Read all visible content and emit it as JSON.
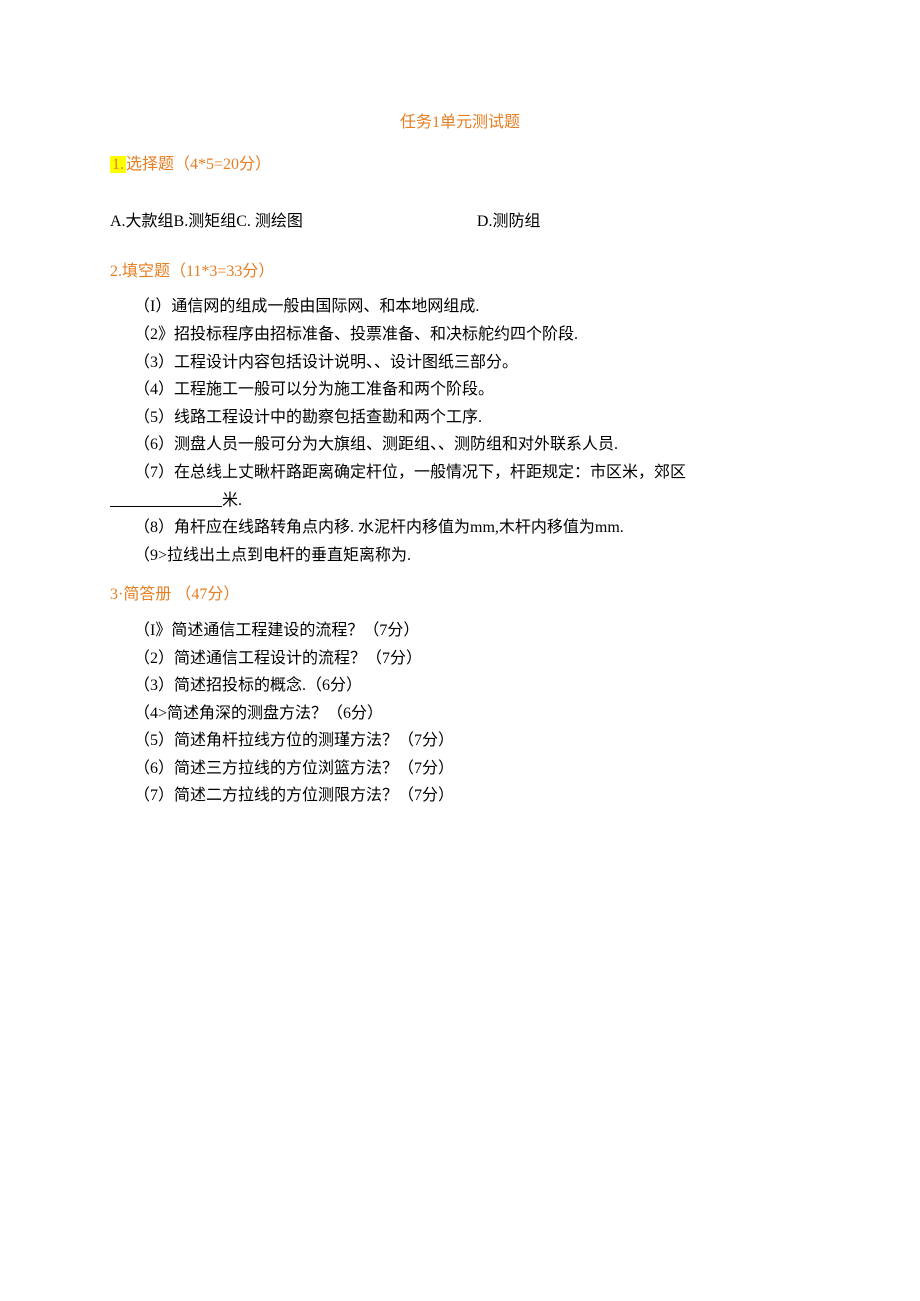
{
  "title": "任务1单元测试题",
  "section1": {
    "heading_num": "1.",
    "heading_text": "选择题（4*5=20分）",
    "choices_abc": "A.大款组B.测矩组C. 测绘图",
    "choice_d": "D.测防组"
  },
  "section2": {
    "heading": "2.填空题（11*3=33分）",
    "items": [
      "（I）通信网的组成一般由国际网、和本地网组成.",
      "（2》招投标程序由招标准备、投票准备、和决标舵约四个阶段.",
      "（3）工程设计内容包括设计说明、、设计图纸三部分。",
      "（4）工程施工一般可以分为施工准备和两个阶段。",
      "（5）线路工程设计中的勘察包括查勘和两个工序.",
      "（6）测盘人员一般可分为大旗组、测距组、、测防组和对外联系人员.",
      "（7）在总线上丈瞅杆路距离确定杆位，一般情况下，杆距规定：市区米，郊区"
    ],
    "item7_suffix": "米.",
    "items_after": [
      "（8）角杆应在线路转角点内移. 水泥杆内移值为mm,木杆内移值为mm.",
      "（9>拉线出土点到电杆的垂直矩离称为."
    ]
  },
  "section3": {
    "heading": "3·简答册 （47分）",
    "items": [
      "（I》简述通信工程建设的流程？（7分）",
      "（2）简述通信工程设计的流程？（7分）",
      "（3）简述招投标的概念.（6分）",
      "（4>简述角深的测盘方法？（6分）",
      "（5）简述角杆拉线方位的测瑾方法？（7分）",
      "（6）简述三方拉线的方位浏篮方法？（7分）",
      "（7）简述二方拉线的方位测限方法？（7分）"
    ]
  }
}
